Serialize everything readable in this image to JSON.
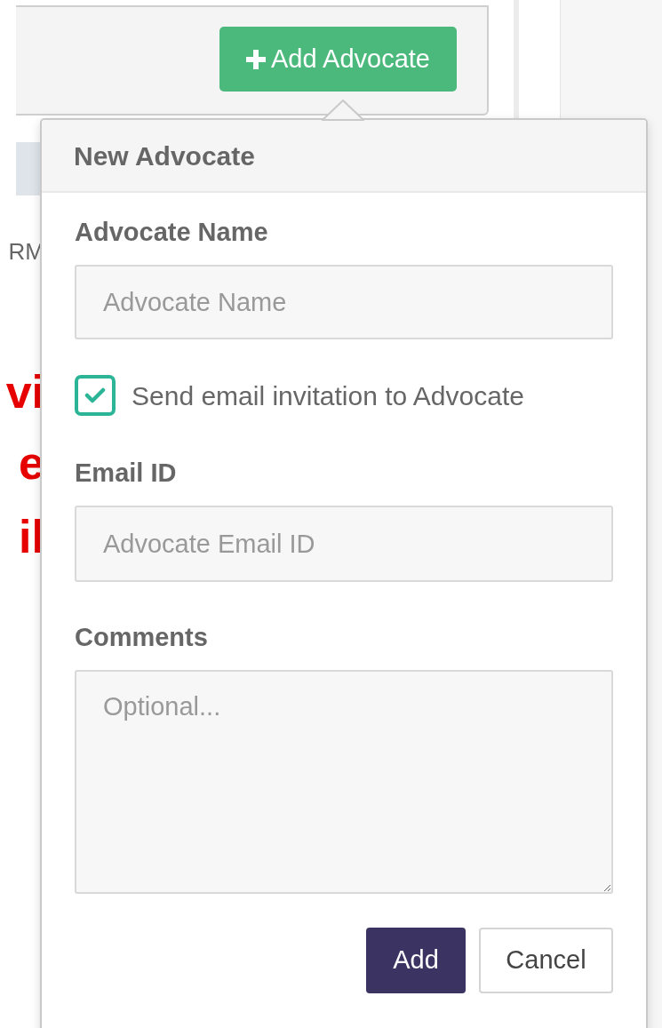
{
  "background": {
    "fragments": [
      {
        "text": "RM",
        "kind": "small"
      },
      {
        "text": "vi",
        "kind": "large"
      },
      {
        "text": "e",
        "kind": "large"
      },
      {
        "text": "il",
        "kind": "large"
      }
    ]
  },
  "toolbar": {
    "add_button": "Add Advocate"
  },
  "popover": {
    "title": "New Advocate",
    "name_field": {
      "label": "Advocate Name",
      "placeholder": "Advocate Name"
    },
    "invite_checkbox": {
      "label": "Send email invitation to Advocate",
      "checked": true
    },
    "email_field": {
      "label": "Email ID",
      "placeholder": "Advocate Email ID"
    },
    "comments_field": {
      "label": "Comments",
      "placeholder": "Optional..."
    },
    "buttons": {
      "primary": "Add",
      "secondary": "Cancel"
    }
  }
}
